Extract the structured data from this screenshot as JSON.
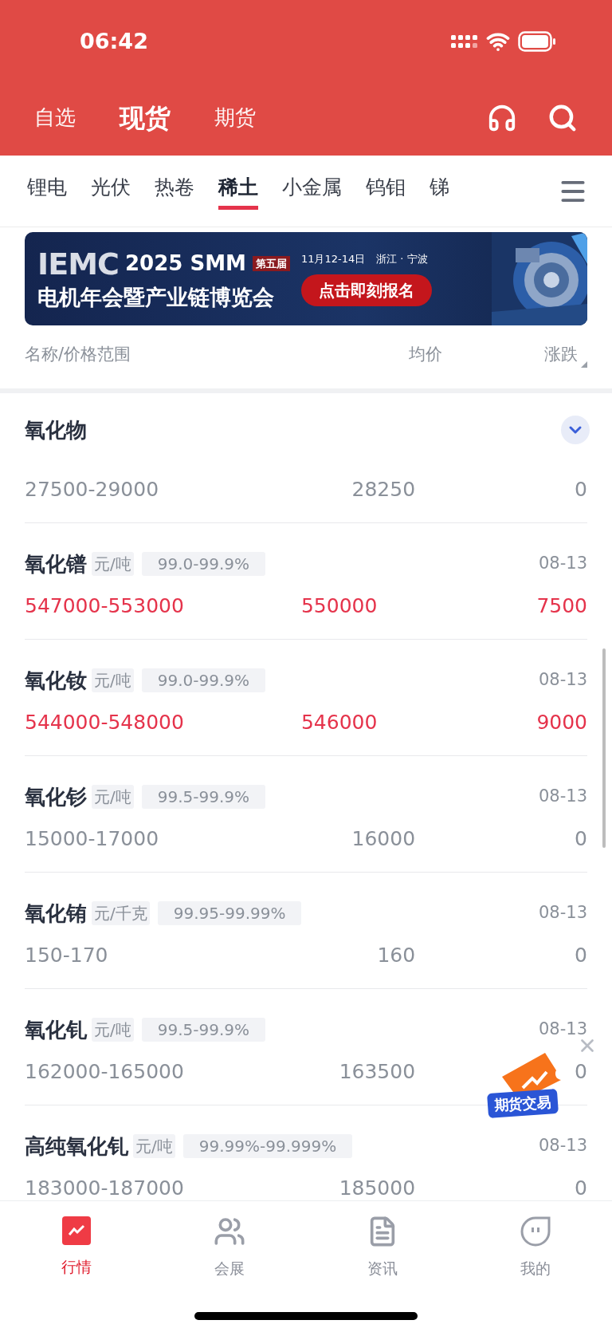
{
  "status_bar": {
    "time": "06:42"
  },
  "header_tabs": [
    {
      "label": "自选",
      "selected": false
    },
    {
      "label": "现货",
      "selected": true
    },
    {
      "label": "期货",
      "selected": false
    }
  ],
  "categories": [
    {
      "label": "锂电",
      "selected": false
    },
    {
      "label": "光伏",
      "selected": false
    },
    {
      "label": "热卷",
      "selected": false
    },
    {
      "label": "稀土",
      "selected": true
    },
    {
      "label": "小金属",
      "selected": false
    },
    {
      "label": "钨钼",
      "selected": false
    },
    {
      "label": "锑",
      "selected": false
    }
  ],
  "banner": {
    "logo": "IEMC",
    "title": "2025 SMM",
    "edition": "第五届",
    "subtitle": "电机年会暨产业链博览会",
    "date": "11月12-14日",
    "location": "浙江 · 宁波",
    "cta": "点击即刻报名"
  },
  "columns": [
    "名称/价格范围",
    "均价",
    "涨跌"
  ],
  "section": {
    "title": "氧化物",
    "expanded": true
  },
  "items": [
    {
      "range": "27500-29000",
      "average": "28250",
      "change": "0",
      "color": "#8a9099"
    },
    {
      "name": "氧化镨",
      "unit": "元/吨",
      "purity": "99.0-99.9%",
      "date": "08-13",
      "range": "547000-553000",
      "average": "550000",
      "change": "7500",
      "color": "#e5334b"
    },
    {
      "name": "氧化钕",
      "unit": "元/吨",
      "purity": "99.0-99.9%",
      "date": "08-13",
      "range": "544000-548000",
      "average": "546000",
      "change": "9000",
      "color": "#e5334b"
    },
    {
      "name": "氧化钐",
      "unit": "元/吨",
      "purity": "99.5-99.9%",
      "date": "08-13",
      "range": "15000-17000",
      "average": "16000",
      "change": "0",
      "color": "#8a9099"
    },
    {
      "name": "氧化铕",
      "unit": "元/千克",
      "purity": "99.95-99.99%",
      "date": "08-13",
      "range": "150-170",
      "average": "160",
      "change": "0",
      "color": "#8a9099"
    },
    {
      "name": "氧化钆",
      "unit": "元/吨",
      "purity": "99.5-99.9%",
      "date": "08-13",
      "range": "162000-165000",
      "average": "163500",
      "change": "0",
      "color": "#8a9099"
    },
    {
      "name": "高纯氧化钆",
      "unit": "元/吨",
      "purity": "99.99%-99.999%",
      "date": "08-13",
      "range": "183000-187000",
      "average": "185000",
      "change": "0",
      "color": "#8a9099"
    }
  ],
  "floating_ad": {
    "label": "期货交易"
  },
  "bottom_nav": [
    {
      "label": "行情",
      "selected": true
    },
    {
      "label": "会展",
      "selected": false
    },
    {
      "label": "资讯",
      "selected": false
    },
    {
      "label": "我的",
      "selected": false
    }
  ]
}
